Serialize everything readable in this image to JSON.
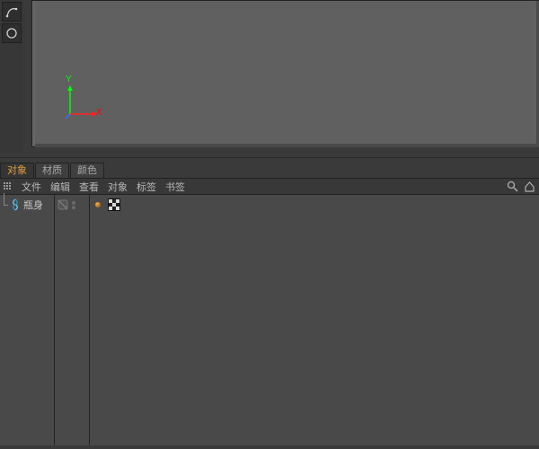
{
  "viewport": {
    "axes": {
      "x_label": "X",
      "y_label": "Y"
    }
  },
  "tabs": {
    "objects": "对象",
    "materials": "材质",
    "colors": "颜色"
  },
  "panel_menu": {
    "file": "文件",
    "edit": "编辑",
    "view": "查看",
    "objects": "对象",
    "tags": "标签",
    "bookmarks": "书签"
  },
  "object_tree": {
    "items": [
      {
        "name": "瓶身"
      }
    ]
  }
}
